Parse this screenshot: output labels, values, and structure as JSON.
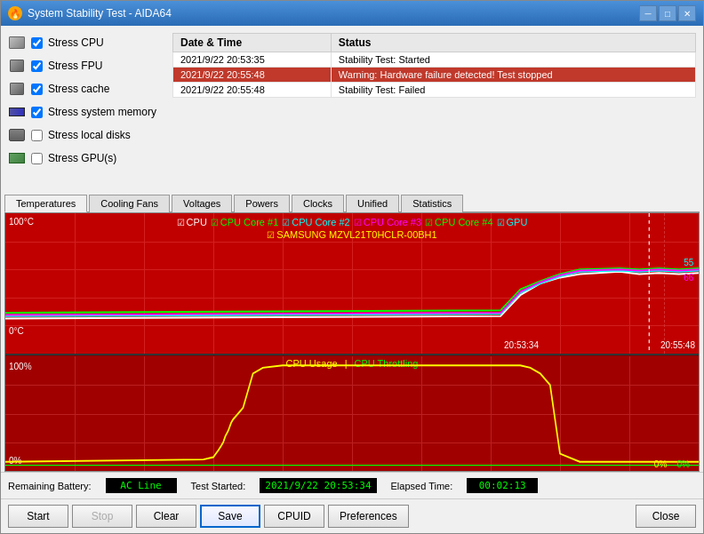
{
  "window": {
    "title": "System Stability Test - AIDA64",
    "icon": "🔥"
  },
  "titlebar": {
    "minimize": "─",
    "maximize": "□",
    "close": "✕"
  },
  "checkboxes": [
    {
      "id": "stress-cpu",
      "label": "Stress CPU",
      "checked": true,
      "icon": "cpu"
    },
    {
      "id": "stress-fpu",
      "label": "Stress FPU",
      "checked": true,
      "icon": "chip"
    },
    {
      "id": "stress-cache",
      "label": "Stress cache",
      "checked": true,
      "icon": "chip"
    },
    {
      "id": "stress-memory",
      "label": "Stress system memory",
      "checked": true,
      "icon": "mem"
    },
    {
      "id": "stress-disks",
      "label": "Stress local disks",
      "checked": false,
      "icon": "disk"
    },
    {
      "id": "stress-gpu",
      "label": "Stress GPU(s)",
      "checked": false,
      "icon": "gpu"
    }
  ],
  "log": {
    "headers": [
      "Date & Time",
      "Status"
    ],
    "rows": [
      {
        "datetime": "2021/9/22 20:53:35",
        "status": "Stability Test: Started",
        "type": "normal"
      },
      {
        "datetime": "2021/9/22 20:55:48",
        "status": "Warning: Hardware failure detected! Test stopped",
        "type": "warning"
      },
      {
        "datetime": "2021/9/22 20:55:48",
        "status": "Stability Test: Failed",
        "type": "failed"
      }
    ]
  },
  "tabs": [
    "Temperatures",
    "Cooling Fans",
    "Voltages",
    "Powers",
    "Clocks",
    "Unified",
    "Statistics"
  ],
  "active_tab": "Temperatures",
  "temp_chart": {
    "legend": [
      {
        "label": "CPU",
        "color": "#ffffff"
      },
      {
        "label": "CPU Core #1",
        "color": "#00ff00"
      },
      {
        "label": "CPU Core #2",
        "color": "#00ffff"
      },
      {
        "label": "CPU Core #3",
        "color": "#ff00ff"
      },
      {
        "label": "CPU Core #4",
        "color": "#00ff00"
      },
      {
        "label": "GPU",
        "color": "#00ffff"
      },
      {
        "label": "SAMSUNG MZVL21T0HCLR-00BH1",
        "color": "#ffff00"
      }
    ],
    "y_top": "100°C",
    "y_bottom": "0°C",
    "x_left": "20:53:34",
    "x_right": "20:55:48",
    "values_right": [
      "55",
      "66"
    ]
  },
  "usage_chart": {
    "legend": [
      {
        "label": "CPU Usage",
        "color": "#ffff00"
      },
      {
        "label": "|",
        "color": "#ffff00"
      },
      {
        "label": "CPU Throttling",
        "color": "#00ff00"
      }
    ],
    "y_top": "100%",
    "y_bottom": "0%",
    "pct_labels": "0%0%"
  },
  "bottom_info": {
    "battery_label": "Remaining Battery:",
    "battery_value": "AC Line",
    "test_started_label": "Test Started:",
    "test_started_value": "2021/9/22 20:53:34",
    "elapsed_label": "Elapsed Time:",
    "elapsed_value": "00:02:13"
  },
  "buttons": {
    "start": "Start",
    "stop": "Stop",
    "clear": "Clear",
    "save": "Save",
    "cpuid": "CPUID",
    "preferences": "Preferences",
    "close": "Close"
  }
}
